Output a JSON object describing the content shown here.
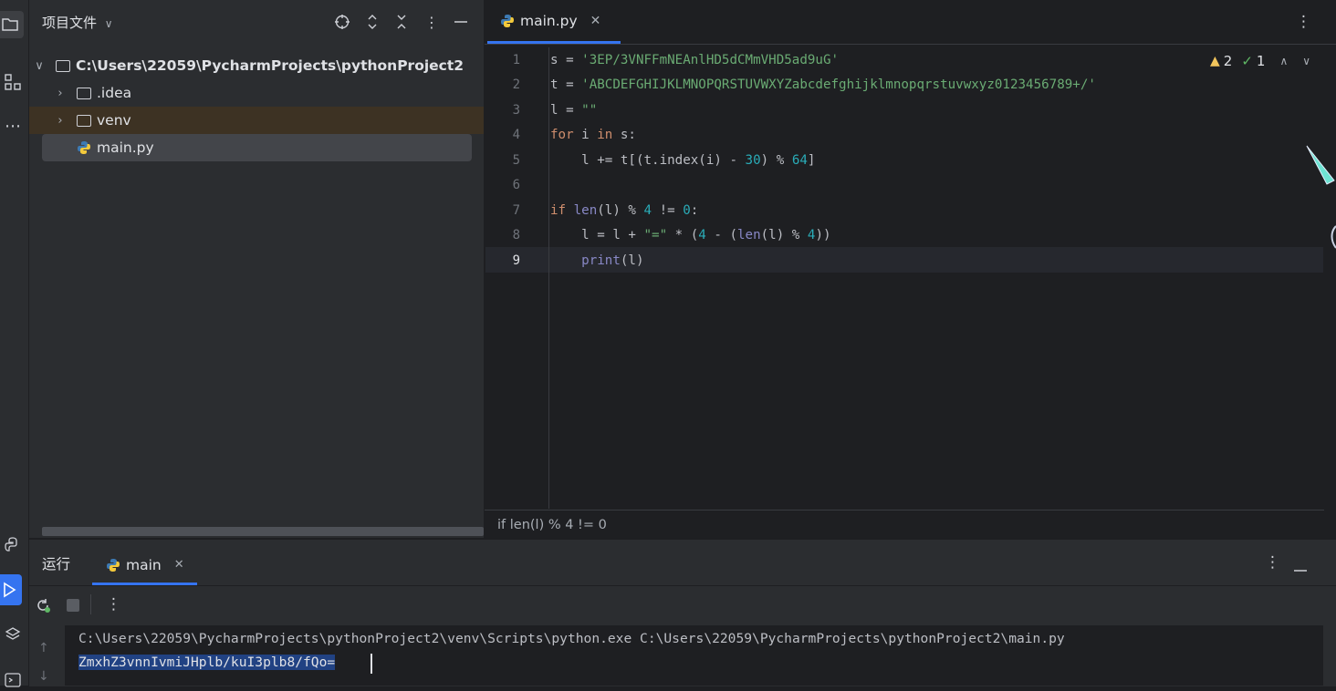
{
  "sidebar_strip": {
    "icons": [
      "folder-icon",
      "structure-icon",
      "more-icon",
      "python-packages-icon",
      "run-icon",
      "layers-icon",
      "terminal-icon"
    ]
  },
  "project_panel": {
    "title": "项目文件",
    "tree": [
      {
        "label": "C:\\Users\\22059\\PycharmProjects\\pythonProject2",
        "type": "folder",
        "expanded": true
      },
      {
        "label": ".idea",
        "type": "folder",
        "expanded": false
      },
      {
        "label": "venv",
        "type": "folder",
        "expanded": false
      },
      {
        "label": "main.py",
        "type": "python-file",
        "selected": true
      }
    ]
  },
  "editor": {
    "tab_label": "main.py",
    "inspection": {
      "warnings": "2",
      "ok": "1"
    },
    "line_numbers": [
      "1",
      "2",
      "3",
      "4",
      "5",
      "6",
      "7",
      "8",
      "9"
    ],
    "lines": [
      "s = '3EP/3VNFFmNEAnlHD5dCMmVHD5ad9uG'",
      "t = 'ABCDEFGHIJKLMNOPQRSTUVWXYZabcdefghijklmnopqrstuvwxyz0123456789+/'",
      "l = \"\"",
      "for i in s:",
      "    l += t[(t.index(i) - 30) % 64]",
      "",
      "if len(l) % 4 != 0:",
      "    l = l + \"=\" * (4 - (len(l) % 4))",
      "    print(l)"
    ],
    "breadcrumb": "if len(l) % 4 != 0"
  },
  "run_panel": {
    "title": "运行",
    "tab_label": "main",
    "command": "C:\\Users\\22059\\PycharmProjects\\pythonProject2\\venv\\Scripts\\python.exe C:\\Users\\22059\\PycharmProjects\\pythonProject2\\main.py",
    "output": "ZmxhZ3vnnIvmiJHplb/kuI3plb8/fQo="
  },
  "colors": {
    "accent": "#3574f0",
    "keyword": "#cf8e6d",
    "string": "#6aab73",
    "number": "#2aacb8",
    "builtin": "#8888c6"
  }
}
